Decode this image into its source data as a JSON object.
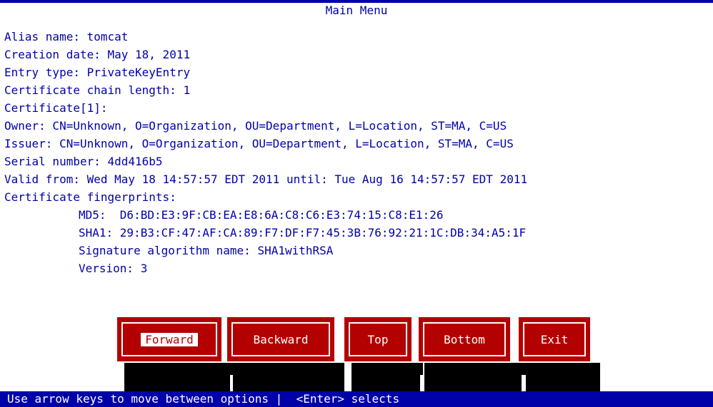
{
  "window": {
    "title": "Main Menu"
  },
  "cert": {
    "alias": "Alias name: tomcat",
    "creation_date": "Creation date: May 18, 2011",
    "entry_type": "Entry type: PrivateKeyEntry",
    "chain_length": "Certificate chain length: 1",
    "certificate_index": "Certificate[1]:",
    "owner": "Owner: CN=Unknown, O=Organization, OU=Department, L=Location, ST=MA, C=US",
    "issuer": "Issuer: CN=Unknown, O=Organization, OU=Department, L=Location, ST=MA, C=US",
    "serial": "Serial number: 4dd416b5",
    "validity": "Valid from: Wed May 18 14:57:57 EDT 2011 until: Tue Aug 16 14:57:57 EDT 2011",
    "fingerprints_heading": "Certificate fingerprints:",
    "md5": "MD5:  D6:BD:E3:9F:CB:EA:E8:6A:C8:C6:E3:74:15:C8:E1:26",
    "sha1": "SHA1: 29:B3:CF:47:AF:CA:89:F7:DF:F7:45:3B:76:92:21:1C:DB:34:A5:1F",
    "signature_algorithm": "Signature algorithm name: SHA1withRSA",
    "version": "Version: 3"
  },
  "buttons": {
    "forward": "Forward",
    "backward": "Backward",
    "top": "Top",
    "bottom": "Bottom",
    "exit": "Exit"
  },
  "status": {
    "hint": "Use arrow keys to move between options |  <Enter> selects"
  },
  "colors": {
    "text": "#0000a8",
    "button_bg": "#b30000",
    "status_bg": "#0000a8",
    "background": "#ffffff"
  }
}
